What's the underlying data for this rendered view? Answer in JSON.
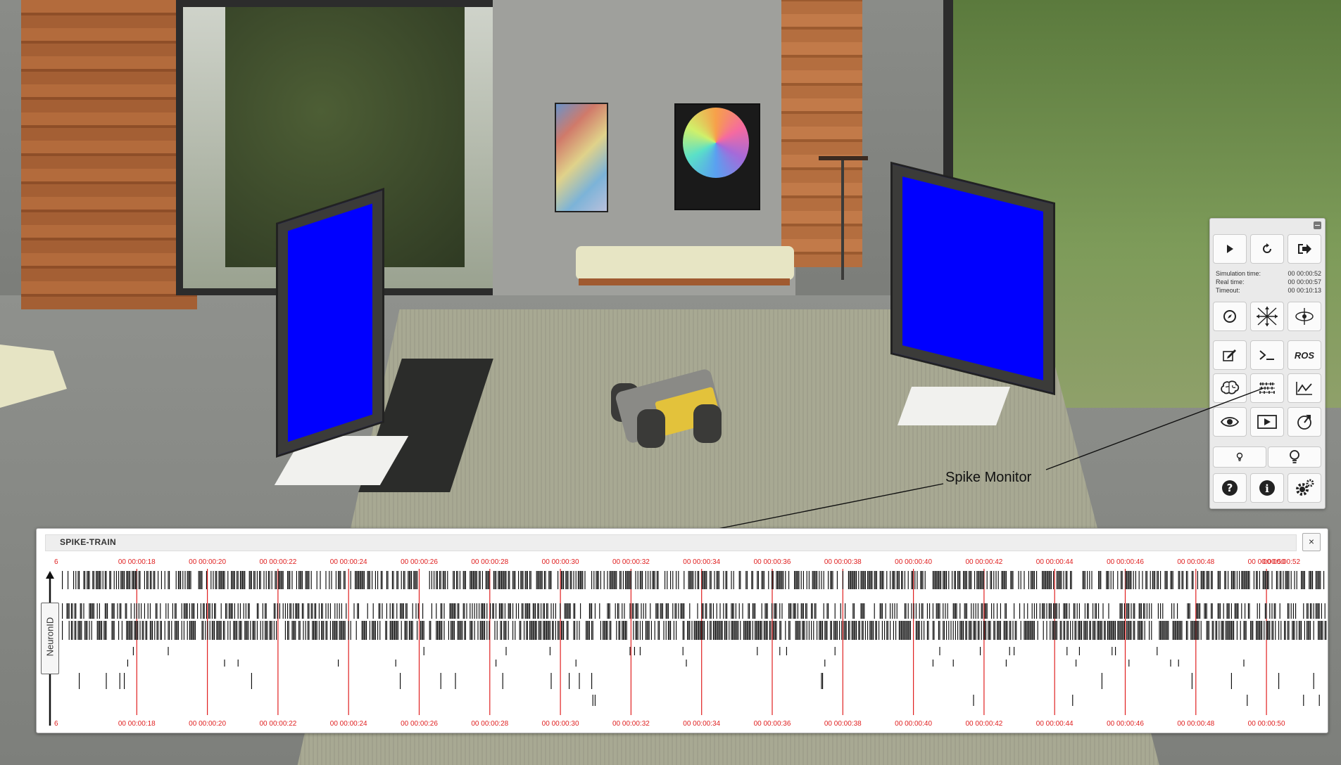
{
  "simulation_panel": {
    "buttons": {
      "play": "play-icon",
      "reset": "reset-icon",
      "exit": "exit-icon",
      "ros": "ROS"
    },
    "times": [
      {
        "label": "Simulation time:",
        "value": "00 00:00:52"
      },
      {
        "label": "Real time:",
        "value": "00 00:00:57"
      },
      {
        "label": "Timeout:",
        "value": "00 00:10:13"
      }
    ]
  },
  "callout": {
    "label": "Spike Monitor"
  },
  "spike_train": {
    "title": "SPIKE-TRAIN",
    "close": "×",
    "y_axis_label": "NeuronID",
    "top_ticks": [
      "6",
      "00 00:00:18",
      "00 00:00:20",
      "00 00:00:22",
      "00 00:00:24",
      "00 00:00:26",
      "00 00:00:28",
      "00 00:00:30",
      "00 00:00:32",
      "00 00:00:34",
      "00 00:00:36",
      "00 00:00:38",
      "00 00:00:40",
      "00 00:00:42",
      "00 00:00:44",
      "00 00:00:46",
      "00 00:00:48",
      "00 00:00:50",
      "00 00:00:52"
    ],
    "bottom_ticks": [
      "6",
      "00 00:00:18",
      "00 00:00:20",
      "00 00:00:22",
      "00 00:00:24",
      "00 00:00:26",
      "00 00:00:28",
      "00 00:00:30",
      "00 00:00:32",
      "00 00:00:34",
      "00 00:00:36",
      "00 00:00:38",
      "00 00:00:40",
      "00 00:00:42",
      "00 00:00:44",
      "00 00:00:46",
      "00 00:00:48",
      "00 00:00:50"
    ],
    "tick_color": "#e02020"
  }
}
